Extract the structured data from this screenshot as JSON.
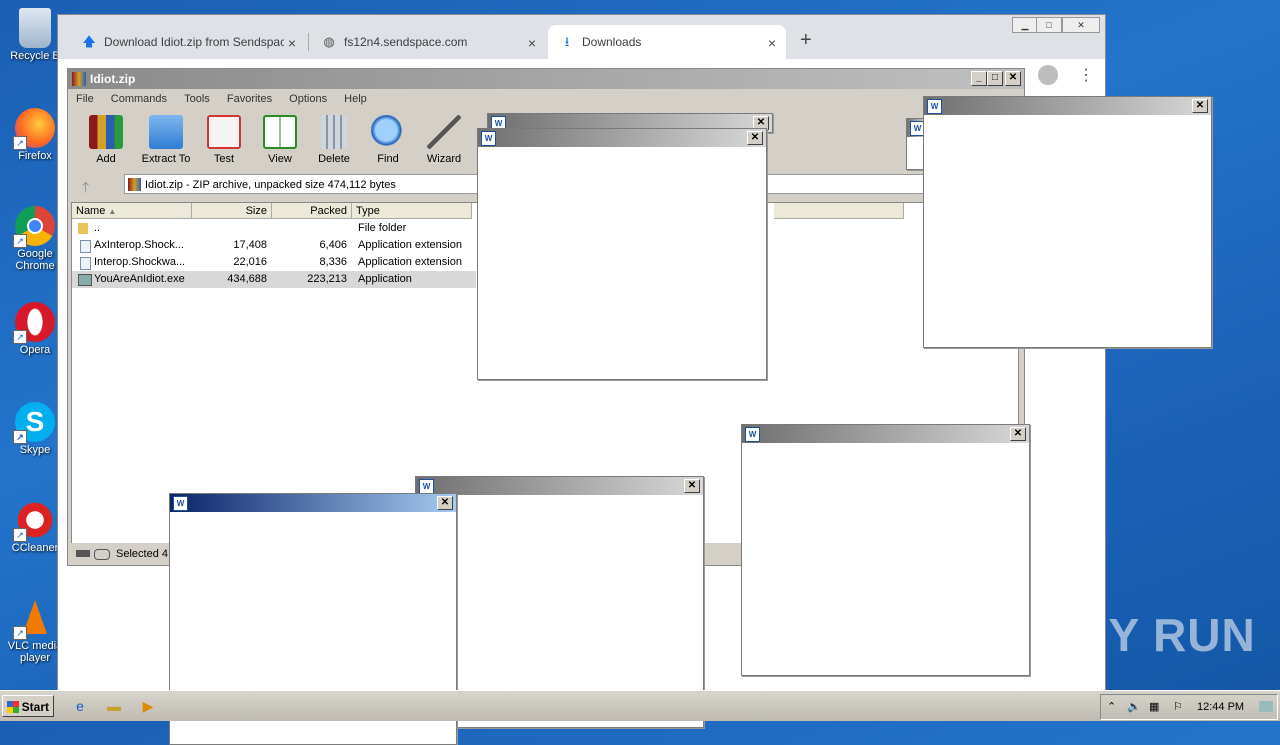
{
  "desktop": {
    "icons": [
      {
        "label": "Recycle B",
        "icon": "recycle-bin-icon"
      },
      {
        "label": "Firefox",
        "icon": "firefox-icon"
      },
      {
        "label": "Google Chrome",
        "icon": "chrome-icon"
      },
      {
        "label": "Opera",
        "icon": "opera-icon"
      },
      {
        "label": "Skype",
        "icon": "skype-icon"
      },
      {
        "label": "CCleaner",
        "icon": "ccleaner-icon"
      },
      {
        "label": "VLC media player",
        "icon": "vlc-icon"
      }
    ]
  },
  "browser": {
    "tabs": [
      {
        "label": "Download Idiot.zip from Sendspace.c",
        "icon": "upload-arrow-icon"
      },
      {
        "label": "fs12n4.sendspace.com",
        "icon": "globe-icon"
      },
      {
        "label": "Downloads",
        "icon": "download-icon"
      }
    ],
    "new_tab": "+",
    "close_glyph": "×"
  },
  "winrar": {
    "title": "Idiot.zip",
    "menu": [
      "File",
      "Commands",
      "Tools",
      "Favorites",
      "Options",
      "Help"
    ],
    "toolbar": [
      "Add",
      "Extract To",
      "Test",
      "View",
      "Delete",
      "Find",
      "Wizard"
    ],
    "address": "Idiot.zip - ZIP archive, unpacked size 474,112 bytes",
    "columns": [
      "Name",
      "Size",
      "Packed",
      "Type"
    ],
    "rows": [
      {
        "name": "..",
        "size": "",
        "packed": "",
        "type": "File folder"
      },
      {
        "name": "AxInterop.Shock...",
        "size": "17,408",
        "packed": "6,406",
        "type": "Application extension"
      },
      {
        "name": "Interop.Shockwa...",
        "size": "22,016",
        "packed": "8,336",
        "type": "Application extension"
      },
      {
        "name": "YouAreAnIdiot.exe",
        "size": "434,688",
        "packed": "223,213",
        "type": "Application"
      }
    ],
    "status": "Selected 4"
  },
  "taskbar": {
    "start": "Start",
    "time": "12:44 PM"
  },
  "watermark": "ANY RUN",
  "popup_close": "✕",
  "popup_icon": "W"
}
